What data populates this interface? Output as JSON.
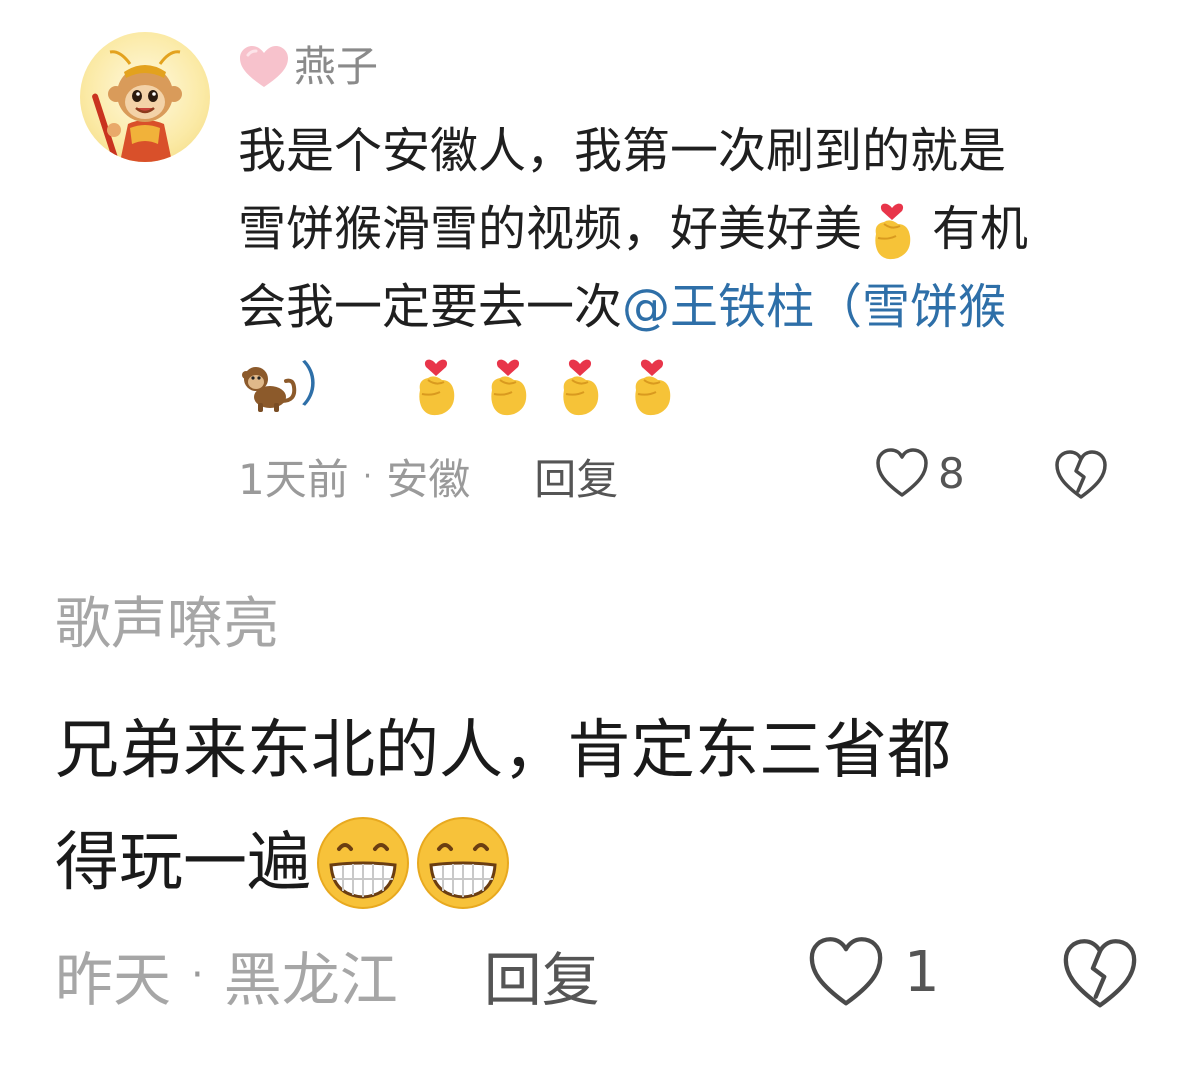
{
  "comments": [
    {
      "username": "燕子",
      "body_lines": [
        "我是个安徽人，我第一次刷到的就是",
        "雪饼猴滑雪的视频，好美好美",
        "有机",
        "会我一定要去一次",
        "@王铁柱（雪饼猴",
        "）"
      ],
      "time": "1天前",
      "separator": "·",
      "location": "安徽",
      "reply_label": "回复",
      "like_count": "8"
    },
    {
      "username": "歌声嘹亮",
      "body_lines": [
        "兄弟来东北的人，肯定东三省都",
        "得玩一遍"
      ],
      "time": "昨天",
      "separator": "·",
      "location": "黑龙江",
      "reply_label": "回复",
      "like_count": "1"
    }
  ],
  "icons": {
    "avatar": "monkey-king-avatar",
    "username_heart": "pink-heart-icon",
    "finger_heart": "finger-heart-emoji",
    "monkey": "monkey-emoji",
    "grin": "grinning-face-emoji",
    "like": "heart-outline-icon",
    "dislike": "broken-heart-icon"
  },
  "colors": {
    "mention": "#2e6fa8",
    "meta_text": "#9a9a9a",
    "username_text": "#8a8a8a",
    "heart_pink": "#f7b8c4"
  }
}
